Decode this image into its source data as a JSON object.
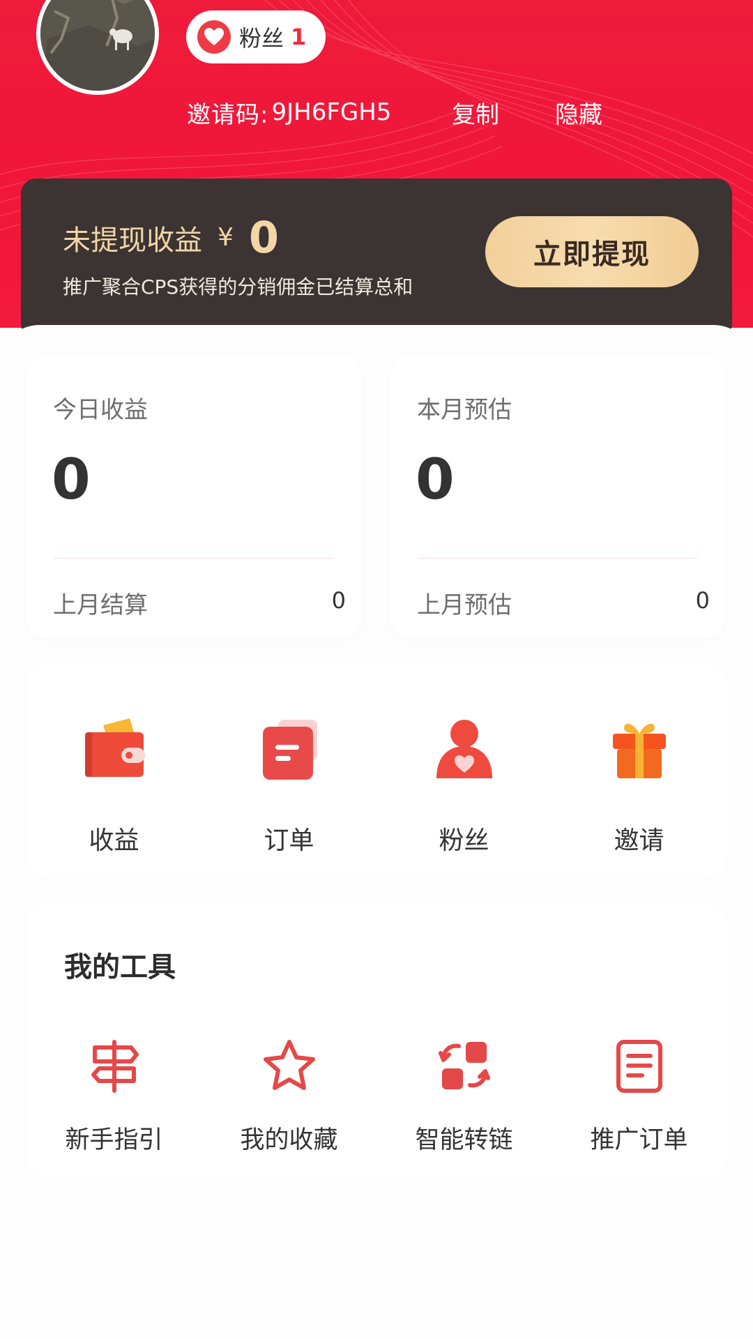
{
  "header": {
    "fans_label": "粉丝",
    "fans_count": "1",
    "invite_label": "邀请码:",
    "invite_code": "9JH6FGH5",
    "copy_label": "复制",
    "hide_label": "隐藏"
  },
  "earnings": {
    "title": "未提现收益",
    "currency": "¥",
    "amount": "0",
    "description": "推广聚合CPS获得的分销佣金已结算总和",
    "withdraw_label": "立即提现"
  },
  "stats": [
    {
      "title": "今日收益",
      "value": "0",
      "sub_label": "上月结算",
      "sub_value": "0"
    },
    {
      "title": "本月预估",
      "value": "0",
      "sub_label": "上月预估",
      "sub_value": "0"
    }
  ],
  "quick_actions": [
    {
      "label": "收益",
      "icon": "wallet-icon"
    },
    {
      "label": "订单",
      "icon": "order-icon"
    },
    {
      "label": "粉丝",
      "icon": "fans-icon"
    },
    {
      "label": "邀请",
      "icon": "gift-icon"
    }
  ],
  "tools": {
    "title": "我的工具",
    "items": [
      {
        "label": "新手指引",
        "icon": "signpost-icon"
      },
      {
        "label": "我的收藏",
        "icon": "star-icon"
      },
      {
        "label": "智能转链",
        "icon": "convert-link-icon"
      },
      {
        "label": "推广订单",
        "icon": "document-icon"
      }
    ]
  },
  "colors": {
    "header_red": "#ef1b3b",
    "banner_dark": "#3b3433",
    "gold_text": "#f4d6a6",
    "icon_red": "#e54848"
  }
}
